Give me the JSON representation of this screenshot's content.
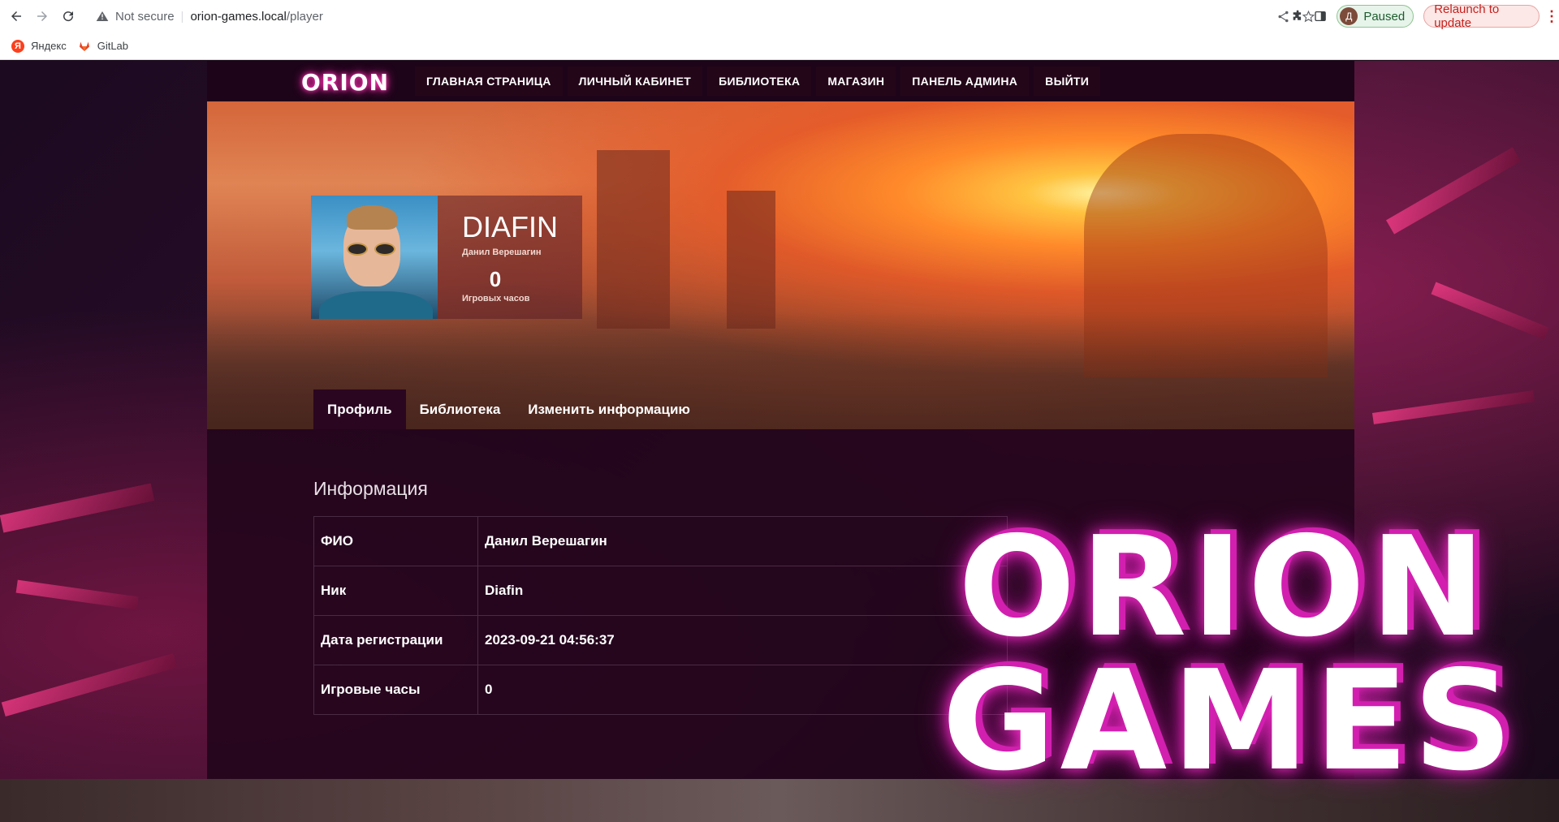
{
  "browser": {
    "not_secure_label": "Not secure",
    "url_host": "orion-games.local",
    "url_path": "/player",
    "profile_initial": "Д",
    "paused_label": "Paused",
    "relaunch_label": "Relaunch to update"
  },
  "bookmarks": [
    {
      "label": "Яндекс",
      "icon": "yandex-icon"
    },
    {
      "label": "GitLab",
      "icon": "gitlab-icon"
    }
  ],
  "site": {
    "logo": "ORION",
    "nav": [
      "ГЛАВНАЯ СТРАНИЦА",
      "ЛИЧНЫЙ КАБИНЕТ",
      "БИБЛИОТЕКА",
      "МАГАЗИН",
      "ПАНЕЛЬ АДМИНА",
      "ВЫЙТИ"
    ]
  },
  "profile": {
    "nick": "DIAFIN",
    "full_name": "Данил Верешагин",
    "hours_value": "0",
    "hours_label": "Игровых часов",
    "tabs": [
      "Профиль",
      "Библиотека",
      "Изменить информацию"
    ],
    "active_tab": "Профиль"
  },
  "info": {
    "title": "Информация",
    "rows": [
      {
        "key": "ФИО",
        "value": "Данил Верешагин"
      },
      {
        "key": "Ник",
        "value": "Diafin"
      },
      {
        "key": "Дата регистрации",
        "value": "2023-09-21 04:56:37"
      },
      {
        "key": "Игровые часы",
        "value": "0"
      }
    ]
  },
  "watermark": {
    "line1": "ORION",
    "line2": "GAMES"
  },
  "colors": {
    "accent": "#ff2fb0",
    "header_bg": "#1d0419",
    "panel_bg": "#20051a"
  }
}
